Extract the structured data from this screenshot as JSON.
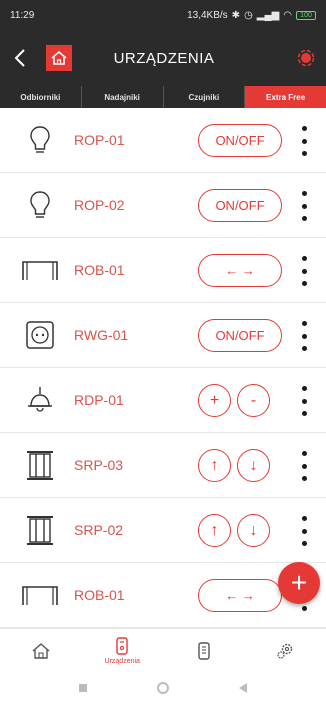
{
  "status_bar": {
    "time": "11:29",
    "net_speed": "13,4KB/s",
    "battery": "100"
  },
  "app_bar": {
    "title": "URZĄDZENIA",
    "back_icon": "chevron-left-icon",
    "home_icon": "home-icon",
    "status_icon": "connection-status-icon"
  },
  "tabs": [
    {
      "label": "Odbiorniki",
      "active": false
    },
    {
      "label": "Nadajniki",
      "active": false
    },
    {
      "label": "Czujniki",
      "active": false
    },
    {
      "label": "Extra Free",
      "active": true
    }
  ],
  "devices": [
    {
      "name": "ROP-01",
      "icon": "bulb-icon",
      "control": "onoff",
      "label": "ON/OFF"
    },
    {
      "name": "ROP-02",
      "icon": "bulb-icon",
      "control": "onoff",
      "label": "ON/OFF"
    },
    {
      "name": "ROB-01",
      "icon": "gate-icon",
      "control": "arrows-lr",
      "label": "← →"
    },
    {
      "name": "RWG-01",
      "icon": "socket-icon",
      "control": "onoff",
      "label": "ON/OFF"
    },
    {
      "name": "RDP-01",
      "icon": "ceiling-lamp-icon",
      "control": "plusminus",
      "labels": [
        "+",
        "-"
      ]
    },
    {
      "name": "SRP-03",
      "icon": "blinds-icon",
      "control": "updown",
      "labels": [
        "↑",
        "↓"
      ]
    },
    {
      "name": "SRP-02",
      "icon": "blinds-icon",
      "control": "updown",
      "labels": [
        "↑",
        "↓"
      ]
    },
    {
      "name": "ROB-01",
      "icon": "gate-icon",
      "control": "arrows-lr",
      "label": "← →"
    }
  ],
  "fab_label": "+",
  "bottom_nav": [
    {
      "icon": "house-icon",
      "label": ""
    },
    {
      "icon": "device-icon",
      "label": "Urządzenia"
    },
    {
      "icon": "remote-icon",
      "label": ""
    },
    {
      "icon": "settings-gears-icon",
      "label": ""
    }
  ],
  "colors": {
    "accent": "#e53935",
    "dark": "#2b2b2b",
    "name_text": "#d9534f"
  }
}
